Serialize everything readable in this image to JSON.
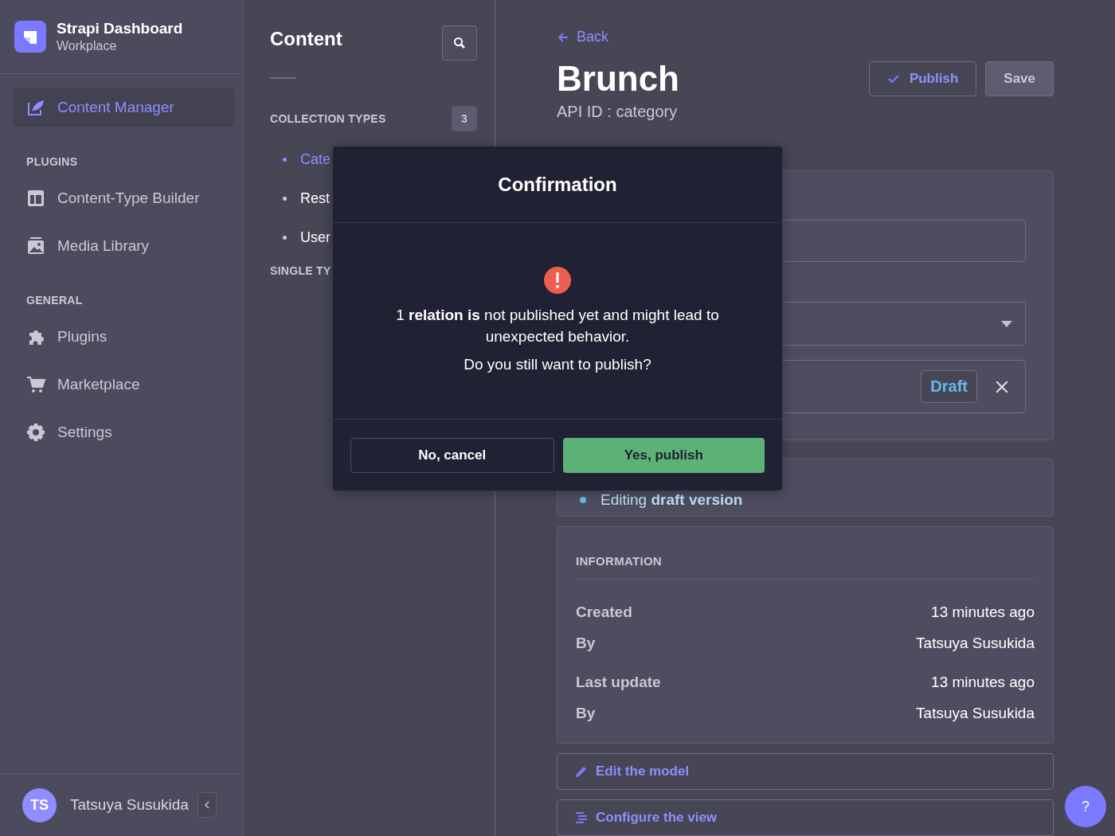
{
  "sidebar": {
    "brand": {
      "title": "Strapi Dashboard",
      "subtitle": "Workplace"
    },
    "sections": [
      {
        "items": [
          {
            "label": "Content Manager",
            "kind": "feather",
            "selected": true
          }
        ]
      },
      {
        "title": "PLUGINS",
        "items": [
          {
            "label": "Content-Type Builder",
            "kind": "layout",
            "selected": false
          },
          {
            "label": "Media Library",
            "kind": "image",
            "selected": false
          }
        ]
      },
      {
        "title": "GENERAL",
        "items": [
          {
            "label": "Plugins",
            "kind": "puzzle",
            "selected": false
          },
          {
            "label": "Marketplace",
            "kind": "cart",
            "selected": false
          },
          {
            "label": "Settings",
            "kind": "gear",
            "selected": false
          }
        ]
      }
    ],
    "user": {
      "initials": "TS",
      "name": "Tatsuya Susukida"
    }
  },
  "content_nav": {
    "title": "Content",
    "groups": [
      {
        "title": "COLLECTION TYPES",
        "count": "3",
        "items": [
          {
            "label": "Cate",
            "selected": true
          },
          {
            "label": "Rest",
            "selected": false
          },
          {
            "label": "User",
            "selected": false
          }
        ]
      },
      {
        "title": "SINGLE TY"
      }
    ]
  },
  "editor": {
    "back": "Back",
    "title": "Brunch",
    "subtitle": "API ID : category",
    "actions": [
      {
        "label": "Publish",
        "kind": "publish"
      },
      {
        "label": "Save",
        "kind": "save"
      }
    ],
    "relation": {
      "status": "Draft"
    },
    "status_text": "Editing **draft version**",
    "information": {
      "title": "INFORMATION",
      "rows": [
        {
          "label": "Created",
          "value": "13 minutes ago"
        },
        {
          "label": "By",
          "value": "Tatsuya Susukida"
        },
        {
          "label": "Last update",
          "value": "13 minutes ago"
        },
        {
          "label": "By",
          "value": "Tatsuya Susukida"
        }
      ]
    },
    "links": [
      {
        "label": "Edit the model",
        "kind": "pencil"
      },
      {
        "label": "Configure the view",
        "kind": "list"
      }
    ]
  },
  "dialog": {
    "title": "Confirmation",
    "message": "1 **relation is** not published yet and might lead to unexpected behavior.",
    "question": "Do you still want to publish?",
    "buttons": [
      {
        "label": "No, cancel",
        "kind": "secondary"
      },
      {
        "label": "Yes, publish",
        "kind": "primary"
      }
    ]
  },
  "help": {
    "label": "?"
  }
}
